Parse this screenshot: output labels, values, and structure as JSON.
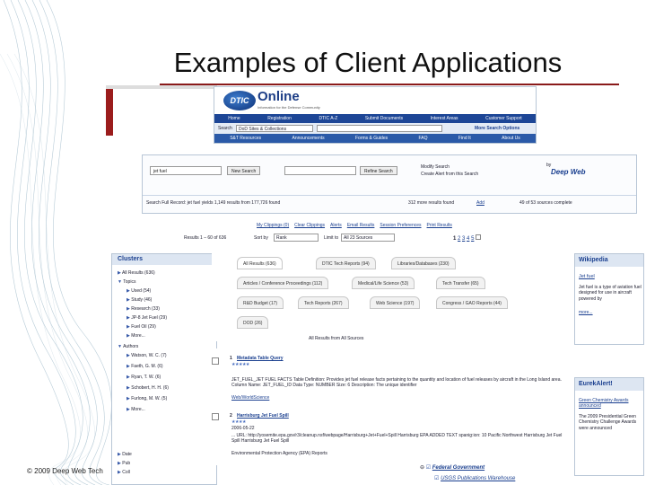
{
  "slide": {
    "title": "Examples of Client Applications",
    "copyright": "© 2009 Deep Web Tech"
  },
  "dtic": {
    "logo_text": "DTIC",
    "online_text": "Online",
    "tagline": "Information for the Defense Community",
    "nav": [
      "Home",
      "Registration",
      "DTIC A-Z",
      "Submit Documents",
      "Interest Areas",
      "Customer Support"
    ],
    "search_label": "Search",
    "search_select": "DoD Sites & Collections",
    "more_options": "More Search Options",
    "subnav": [
      "S&T Resources",
      "Announcements",
      "Forms & Guides",
      "FAQ",
      "Find It",
      "About Us"
    ]
  },
  "deepweb": {
    "query_value": "jet fuel",
    "new_search_btn": "New Search",
    "refine_btn": "Refine Search",
    "modify_search": "Modify Search",
    "create_alert": "Create Alert from this Search",
    "by_label": "by",
    "logo": "Deep Web",
    "status_text": "Search Full Record: jet fuel yields 1,149 results from 177,726 found",
    "more_results": "312 more results found",
    "add_link": "Add",
    "sources_complete": "49 of 53 sources complete"
  },
  "links_bar": [
    "My Clippings (0)",
    "Clear Clippings",
    "Alerts",
    "Email Results",
    "Session Preferences",
    "Print Results"
  ],
  "results_bar": {
    "results_label": "Results 1 – 60 of 636",
    "sort_label": "Sort by",
    "sort_value": "Rank",
    "limit_label": "Limit to",
    "limit_value": "All 23 Sources",
    "pages": [
      "1",
      "2",
      "3",
      "4",
      "5"
    ]
  },
  "clusters": {
    "header": "Clusters",
    "all_results": "All Results (636)",
    "topics_label": "Topics",
    "topics": [
      "Used (54)",
      "Study (46)",
      "Research (33)",
      "JP-8 Jet Fuel (29)",
      "Fuel Oil (29)",
      "More..."
    ],
    "authors_label": "Authors",
    "authors": [
      "Watson, W. C. (7)",
      "Faeth, G. M. (6)",
      "Ryan, T. W. (6)",
      "Schobert, H. H. (6)",
      "Furlong, M. W. (5)",
      "More..."
    ],
    "bottom": [
      "Date",
      "Pub",
      "Coll"
    ]
  },
  "source_tabs": {
    "row1": [
      "All Results (636)",
      "DTIC Tech Reports (94)",
      "Libraries/Databases (230)"
    ],
    "row2": [
      "Articles / Conference Proceedings (112)",
      "Medical/Life Science (53)",
      "Tech Transfer (65)"
    ],
    "row3": [
      "R&D Budget (17)",
      "Tech Reports (267)",
      "Web Science (197)",
      "Congress / GAO Reports (44)"
    ],
    "row4": [
      "DOD (26)"
    ],
    "all_sources": "All Results from All Sources"
  },
  "results": [
    {
      "num": "1",
      "title": "Metadata Table Query",
      "stars": "★★★★★",
      "text": "JET_FUEL_JET FUEL FACTS Table Definition: Provides jet fuel release facts pertaining to the quantity and location of fuel releases by aircraft in the Long Island area. Column Name: JET_FUEL_ID Data Type: NUMBER Size: 6 Description: The unique identifier",
      "source": "Web/WorldScience"
    },
    {
      "num": "2",
      "title": "Harrisburg Jet Fuel Spill",
      "stars": "★★★★",
      "date": "2006-05-22",
      "text": "... URL: http://yosemite.epa.gov/r3/cleanup.nsf/webpage/Harrisburg+Jet+Fuel+Spill Harrisburg EPA ADDED TEXT spanig:ion: 10 Pacific Northwest Harrisburg Jet Fuel Spill Harrisburg Jet Fuel Spill",
      "source": "Environmental Protection Agency (EPA) Reports"
    }
  ],
  "wikipedia": {
    "header": "Wikipedia",
    "link": "Jet fuel",
    "snippet": "Jet fuel is a type of aviation fuel designed for use in aircraft powered by",
    "more": "more..."
  },
  "eurekalert": {
    "header": "EurekAlert!",
    "link": "Green Chemistry Awards announced",
    "snippet": "The 2009 Presidential Green Chemistry Challenge Awards were announced"
  },
  "footer_links": [
    "Federal Government",
    "USGS Publications Warehouse"
  ]
}
